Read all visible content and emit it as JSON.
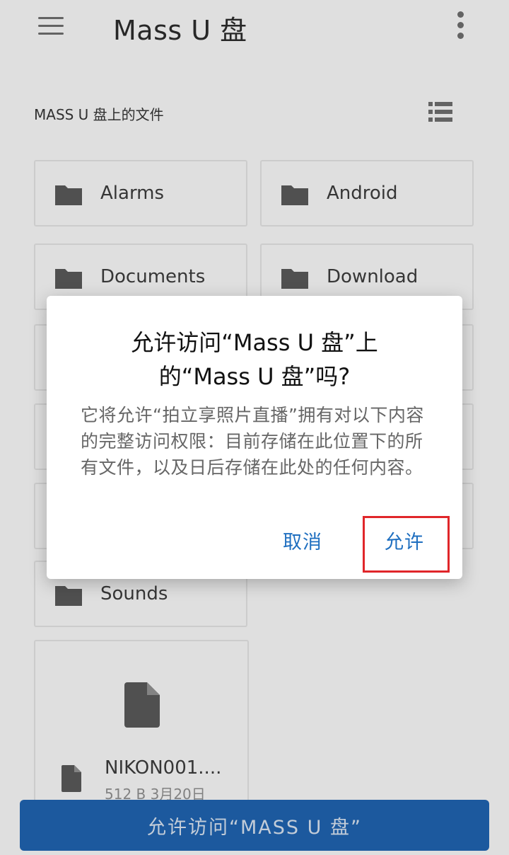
{
  "app_bar": {
    "title": "Mass U 盘",
    "menu_icon": "hamburger-menu-icon",
    "more_icon": "more-vertical-icon"
  },
  "section": {
    "title": "MASS U 盘上的文件",
    "view_toggle_icon": "list-view-icon"
  },
  "folders": [
    {
      "name": "Alarms"
    },
    {
      "name": "Android"
    },
    {
      "name": "Documents"
    },
    {
      "name": "Download"
    },
    {
      "name": "Sounds"
    }
  ],
  "file": {
    "name": "NIKON001....",
    "meta": "512 B 3月20日"
  },
  "bottom_button": {
    "label": "允许访问“MASS U 盘”"
  },
  "dialog": {
    "title_line1": "允许访问“Mass U 盘”上",
    "title_line2": "的“Mass U 盘”吗?",
    "body": "它将允许“拍立享照片直播”拥有对以下内容的完整访问权限：目前存储在此位置下的所有文件，以及日后存储在此处的任何内容。",
    "cancel_label": "取消",
    "allow_label": "允许"
  },
  "colors": {
    "accent": "#1f6fc0",
    "bottom_button_bg": "#1e5fa8",
    "highlight": "#e0262a",
    "icon_gray": "#555555"
  }
}
